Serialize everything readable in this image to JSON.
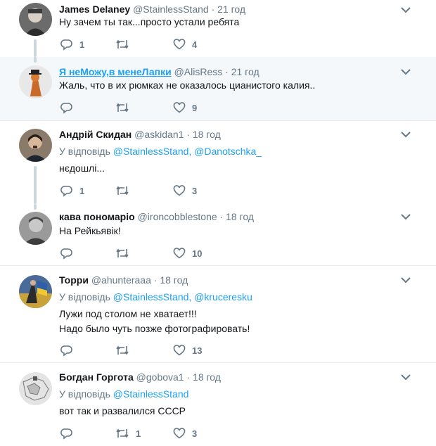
{
  "tweets": [
    {
      "name": "James Delaney",
      "handle": "@StainlessStand",
      "time": "21 год",
      "text_lines": [
        "Ну зачем ты так...просто устали ребята"
      ],
      "reply_count": "1",
      "retweet_count": "",
      "like_count": "4"
    },
    {
      "name": "Я неМожу,в менеЛапки",
      "handle": "@AlisRess",
      "time": "21 год",
      "text_lines": [
        "Жаль, что в их рюмках не оказалось цианистого калия.."
      ],
      "reply_count": "",
      "retweet_count": "",
      "like_count": "9"
    },
    {
      "name": "Андрій Скидан",
      "handle": "@askidan1",
      "time": "18 год",
      "replying_prefix": "У відповідь",
      "mentions": [
        "@StainlessStand,",
        "@Danotschka_"
      ],
      "text_lines": [
        "нєдошлі..."
      ],
      "reply_count": "1",
      "retweet_count": "",
      "like_count": "3"
    },
    {
      "name": "кава пономаріо",
      "handle": "@ironcobblestone",
      "time": "18 год",
      "text_lines": [
        "На Рейкьявік!"
      ],
      "reply_count": "",
      "retweet_count": "",
      "like_count": "10"
    },
    {
      "name": "Торри",
      "handle": "@ahunteraaa",
      "time": "18 год",
      "replying_prefix": "У відповідь",
      "mentions": [
        "@StainlessStand,",
        "@kruceresku"
      ],
      "text_lines": [
        "Лужи под столом не хватает!!!",
        "Надо было чуть позже фотографировать!"
      ],
      "reply_count": "",
      "retweet_count": "",
      "like_count": "13"
    },
    {
      "name": "Богдан Горгота",
      "handle": "@gobova1",
      "time": "18 год",
      "replying_prefix": "У відповідь",
      "mentions": [
        "@StainlessStand"
      ],
      "text_lines": [
        "вот так и развалился СССР"
      ],
      "reply_count": "",
      "retweet_count": "1",
      "like_count": "3"
    }
  ],
  "separator": "·",
  "icons": {
    "reply": "reply-icon",
    "retweet": "retweet-icon",
    "like": "heart-icon",
    "more": "chevron-down-icon"
  },
  "colors": {
    "link": "#1da1f2",
    "secondary": "#657786",
    "thread_line": "#ccd6dd",
    "highlight_bg": "#f5f8fa"
  }
}
